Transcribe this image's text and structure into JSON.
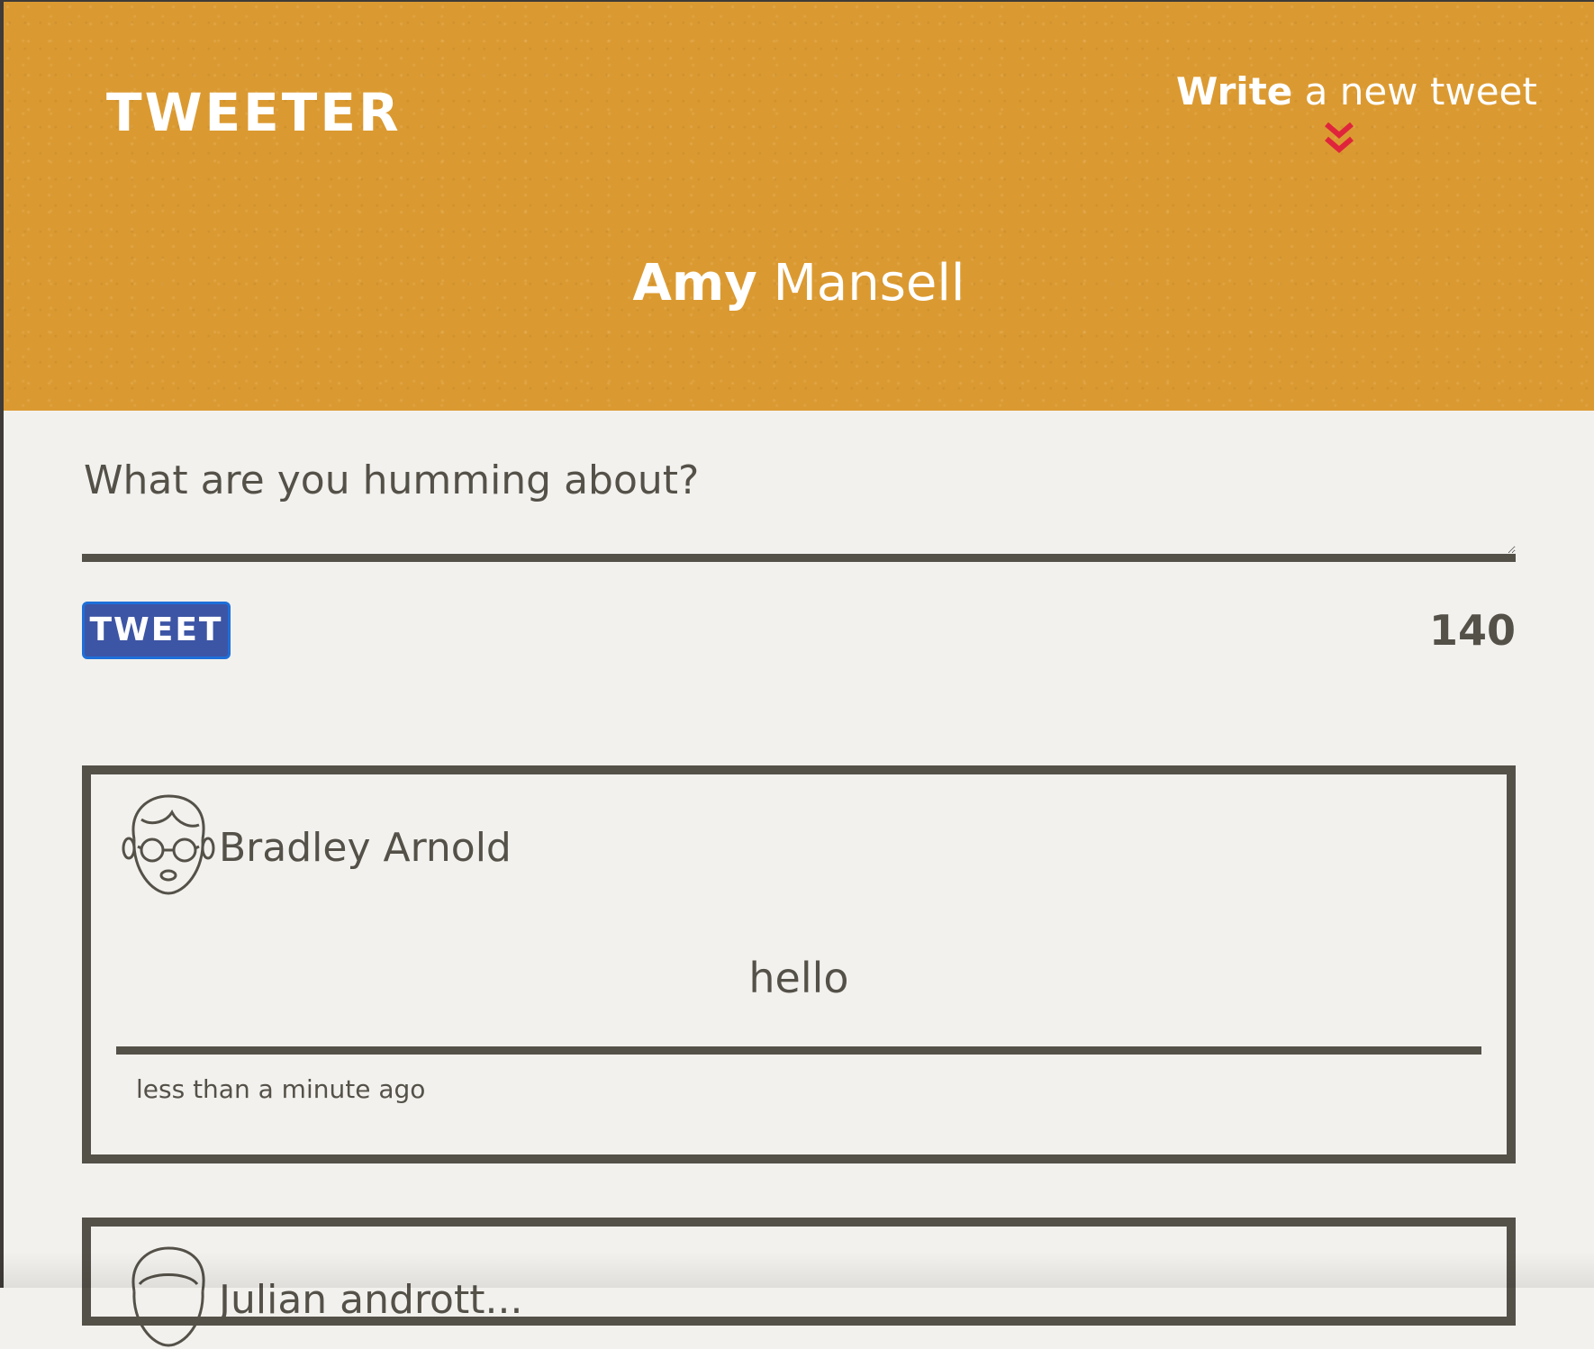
{
  "header": {
    "brand": "TWEETER",
    "compose_toggle": {
      "strong": "Write",
      "rest": "a new tweet"
    },
    "profile": {
      "first_name": "Amy",
      "last_name": "Mansell"
    }
  },
  "composer": {
    "placeholder": "What are you humming about?",
    "value": "",
    "submit_label": "TWEET",
    "char_count": "140"
  },
  "colors": {
    "header_background": "#db9a31",
    "page_background": "#f3f1ed",
    "text": "#545149",
    "button": "#3d55a5",
    "chevron": "#e0243c"
  },
  "tweets": [
    {
      "author": "Bradley Arnold",
      "avatar_icon": "avatar-glasses-icon",
      "content": "hello",
      "timestamp": "less than a minute ago"
    },
    {
      "author": "Julian  andrott... ",
      "avatar_icon": "avatar-icon"
    }
  ]
}
